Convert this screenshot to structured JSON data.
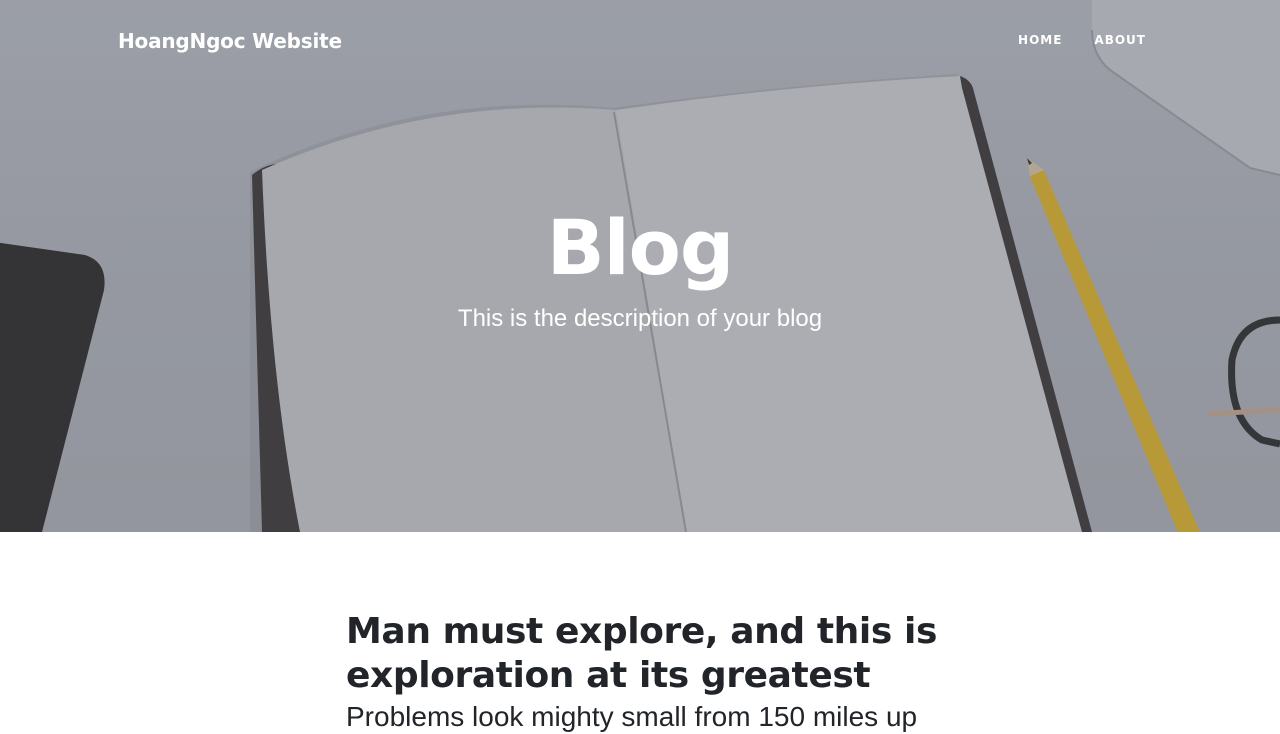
{
  "navbar": {
    "brand": "HoangNgoc Website",
    "links": [
      {
        "label": "HOME"
      },
      {
        "label": "ABOUT"
      }
    ]
  },
  "header": {
    "title": "Blog",
    "subtitle": "This is the description of your blog"
  },
  "posts": [
    {
      "title": "Man must explore, and this is exploration at its greatest",
      "subtitle": "Problems look mighty small from 150 miles up"
    }
  ],
  "colors": {
    "hero_overlay": "#6f737b",
    "text_dark": "#212529",
    "text_light": "#ffffff",
    "pencil": "#e0b52a"
  }
}
